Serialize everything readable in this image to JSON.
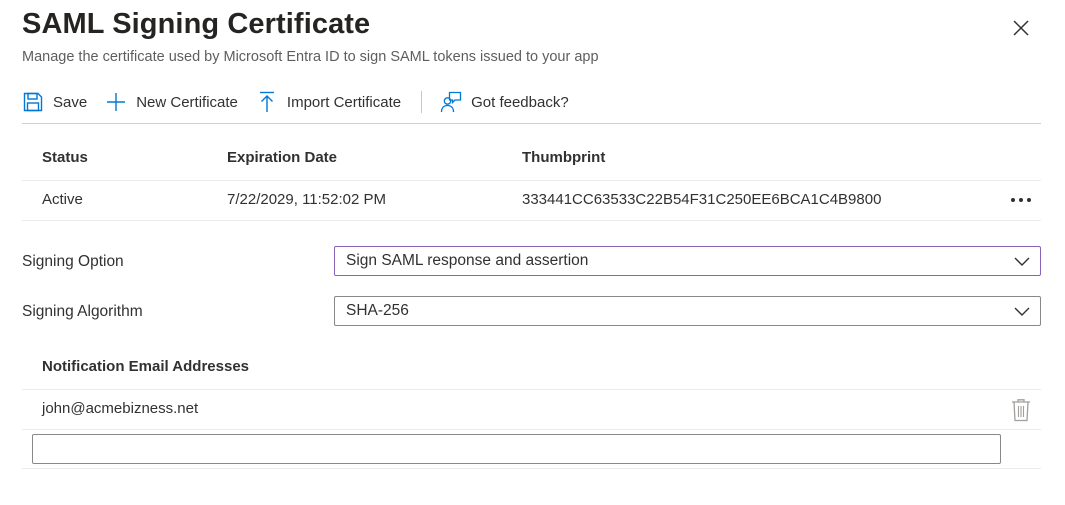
{
  "header": {
    "title": "SAML Signing Certificate",
    "subtitle": "Manage the certificate used by Microsoft Entra ID to sign SAML tokens issued to your app",
    "close_icon": "close-icon"
  },
  "toolbar": {
    "save_label": "Save",
    "new_certificate_label": "New Certificate",
    "import_certificate_label": "Import Certificate",
    "feedback_label": "Got feedback?"
  },
  "certificates": {
    "columns": [
      "Status",
      "Expiration Date",
      "Thumbprint"
    ],
    "rows": [
      {
        "status": "Active",
        "expiration": "7/22/2029, 11:52:02 PM",
        "thumbprint": "333441CC63533C22B54F31C250EE6BCA1C4B9800"
      }
    ]
  },
  "signing": {
    "option_label": "Signing Option",
    "option_value": "Sign SAML response and assertion",
    "algorithm_label": "Signing Algorithm",
    "algorithm_value": "SHA-256"
  },
  "notifications": {
    "header": "Notification Email Addresses",
    "emails": [
      "john@acmebizness.net"
    ],
    "new_email_value": ""
  },
  "colors": {
    "accent": "#0078d4",
    "focus_border": "#8764b8",
    "text": "#323130",
    "muted_text": "#605e5c"
  }
}
